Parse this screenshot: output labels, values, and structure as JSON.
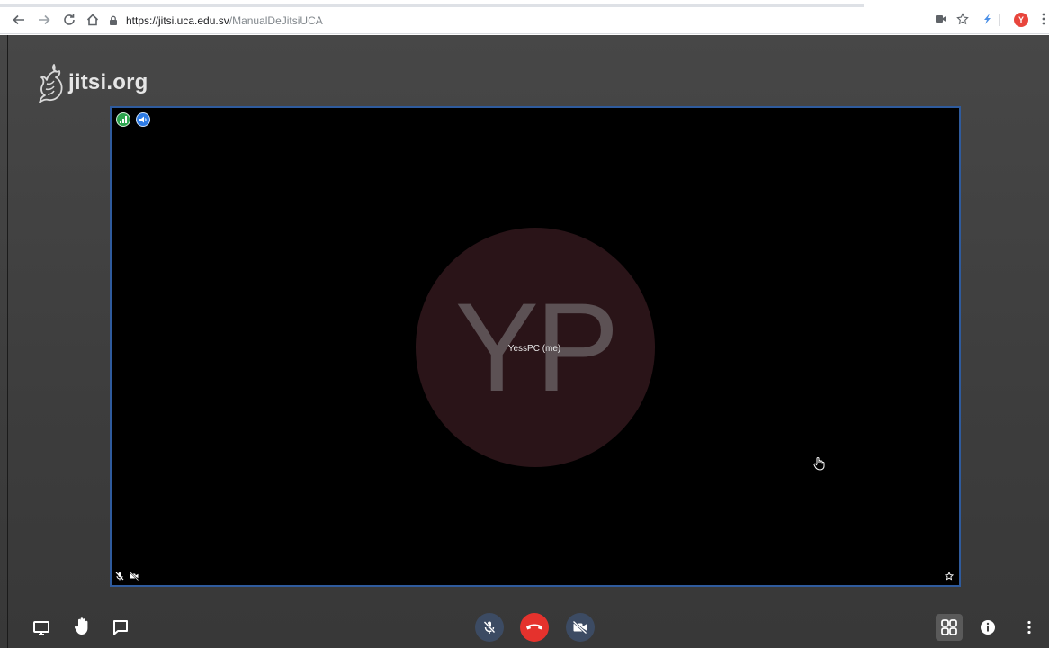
{
  "browser": {
    "url_host": "https://jitsi.uca.edu.sv",
    "url_path": "/ManualDeJitsiUCA",
    "profile_initial": "Y"
  },
  "page": {
    "logo_text": "jitsi.org"
  },
  "stage": {
    "avatar_initials": "YP",
    "display_name": "YessPC (me)",
    "avatar_color": "#2a1418",
    "border_color": "#2f5b9d"
  },
  "toolbar": {
    "left": [
      "screen-share-icon",
      "raise-hand-icon",
      "chat-icon"
    ],
    "center": [
      "microphone-muted-icon",
      "hangup-icon",
      "camera-off-icon"
    ],
    "right": [
      "tile-view-icon",
      "info-icon",
      "more-options-icon"
    ],
    "hangup_color": "#e5322d"
  }
}
